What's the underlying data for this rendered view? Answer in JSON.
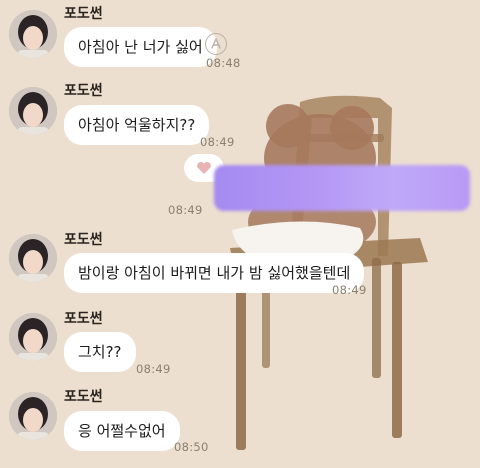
{
  "chat": {
    "sender_name": "포도썬",
    "messages": [
      {
        "text": "아침아 난 너가 싫어",
        "time": "08:48"
      },
      {
        "text": "아침아 억울하지??",
        "time": "08:49"
      },
      {
        "text": "밤이랑 아침이 바뀌면 내가 밤 싫어했을텐데",
        "time": "08:49"
      },
      {
        "text": "그치??",
        "time": "08:49"
      },
      {
        "text": "응 어쩔수없어",
        "time": "08:50"
      }
    ],
    "my_reply": {
      "time": "08:49"
    }
  },
  "icons": {
    "reply": "reply-icon",
    "heart": "heart-reaction-icon"
  },
  "colors": {
    "background": "#ecdfcf",
    "bubble": "#ffffff",
    "censor": "#b497f5",
    "heart": "#e8b3b3"
  }
}
